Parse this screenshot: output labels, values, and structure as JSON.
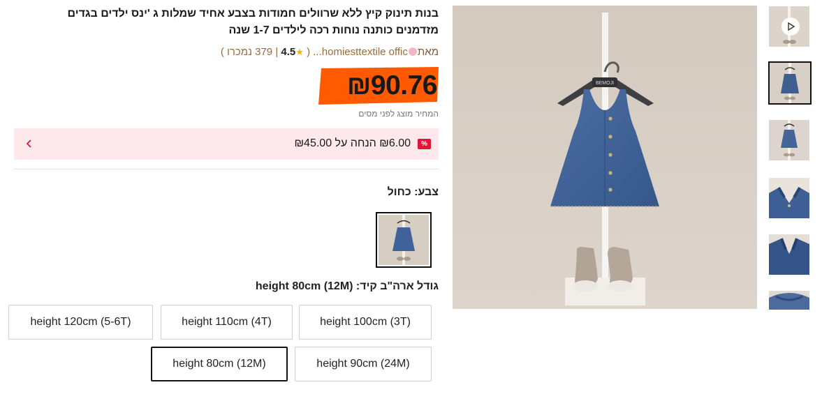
{
  "product": {
    "title_line1": "בנות תינוק קיץ ללא שרוולים חמודות בצבע אחיד שמלות ג 'ינס ילדים בגדים",
    "title_line2": "מזדמנים כותנה נוחות רכה לילדים 1-7 שנה",
    "store_from": "מאת",
    "store_name": "homiesttextile offic...",
    "store_icon": "store-flower-icon",
    "rating": "4.5",
    "star_icon": "star-icon",
    "reviews": "379",
    "sold_text": "נמכרו",
    "price": "₪90.76",
    "tax_note": "המחיר מוצג לפני מסים",
    "brand_color": "#ff5a00",
    "discount": {
      "tag": "%",
      "text": "₪6.00 הנחה על ₪45.00",
      "tag_color": "#e5133a",
      "bg_color": "#fde9ec"
    },
    "color_label": "צבע: כחול",
    "size_label": "גודל ארה\"ב קיד: height 80cm (12M)",
    "sizes": [
      "height 120cm (5-6T)",
      "height 110cm (4T)",
      "height 100cm (3T)",
      "height 80cm (12M)",
      "height 90cm (24M)"
    ],
    "selected_size": "height 80cm (12M)"
  },
  "gallery": {
    "main_icon": "denim-dress-photo",
    "thumbnails": [
      "video-thumb",
      "dress-front-thumb",
      "dress-front-small-thumb",
      "back-straps-thumb",
      "back-closeup-thumb",
      "fabric-detail-thumb"
    ],
    "selected_index": 1,
    "play_icon": "play-icon"
  }
}
